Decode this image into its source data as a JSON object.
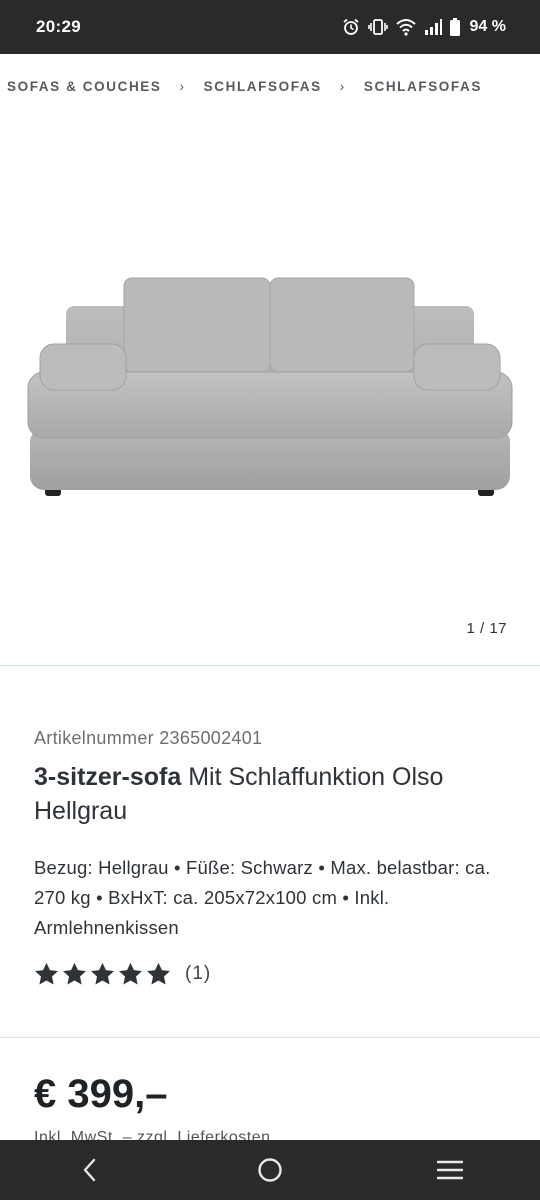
{
  "status_bar": {
    "time": "20:29",
    "battery": "94 %",
    "icons": [
      "alarm-icon",
      "vibrate-icon",
      "wifi-icon",
      "signal-icon",
      "battery-icon"
    ]
  },
  "breadcrumb": {
    "items": [
      "SOFAS & COUCHES",
      "SCHLAFSOFAS",
      "SCHLAFSOFAS"
    ],
    "separator": "›"
  },
  "gallery": {
    "counter": "1 / 17",
    "image_alt": "3-sitzer-sofa Olso Hellgrau"
  },
  "product": {
    "article_number": "Artikelnummer 2365002401",
    "title_strong": "3-sitzer-sofa",
    "title_rest": " Mit Schlaffunktion Olso Hellgrau",
    "specs": "Bezug: Hellgrau • Füße: Schwarz • Max. belastbar: ca. 270 kg • BxHxT: ca. 205x72x100 cm • Inkl. Armlehnenkissen",
    "rating_stars": 5,
    "rating_count": "(1)",
    "price": "€ 399,–",
    "price_note": "Inkl. MwSt. – zzgl. Lieferkosten"
  },
  "nav_bar": {
    "icons": [
      "back-icon",
      "home-icon",
      "recents-icon"
    ]
  },
  "colors": {
    "status_bar_bg": "#2a2a2a",
    "text_primary": "#2e3338",
    "divider_accent": "#cfe1ea",
    "sofa_fabric": "#b4b4b4"
  }
}
